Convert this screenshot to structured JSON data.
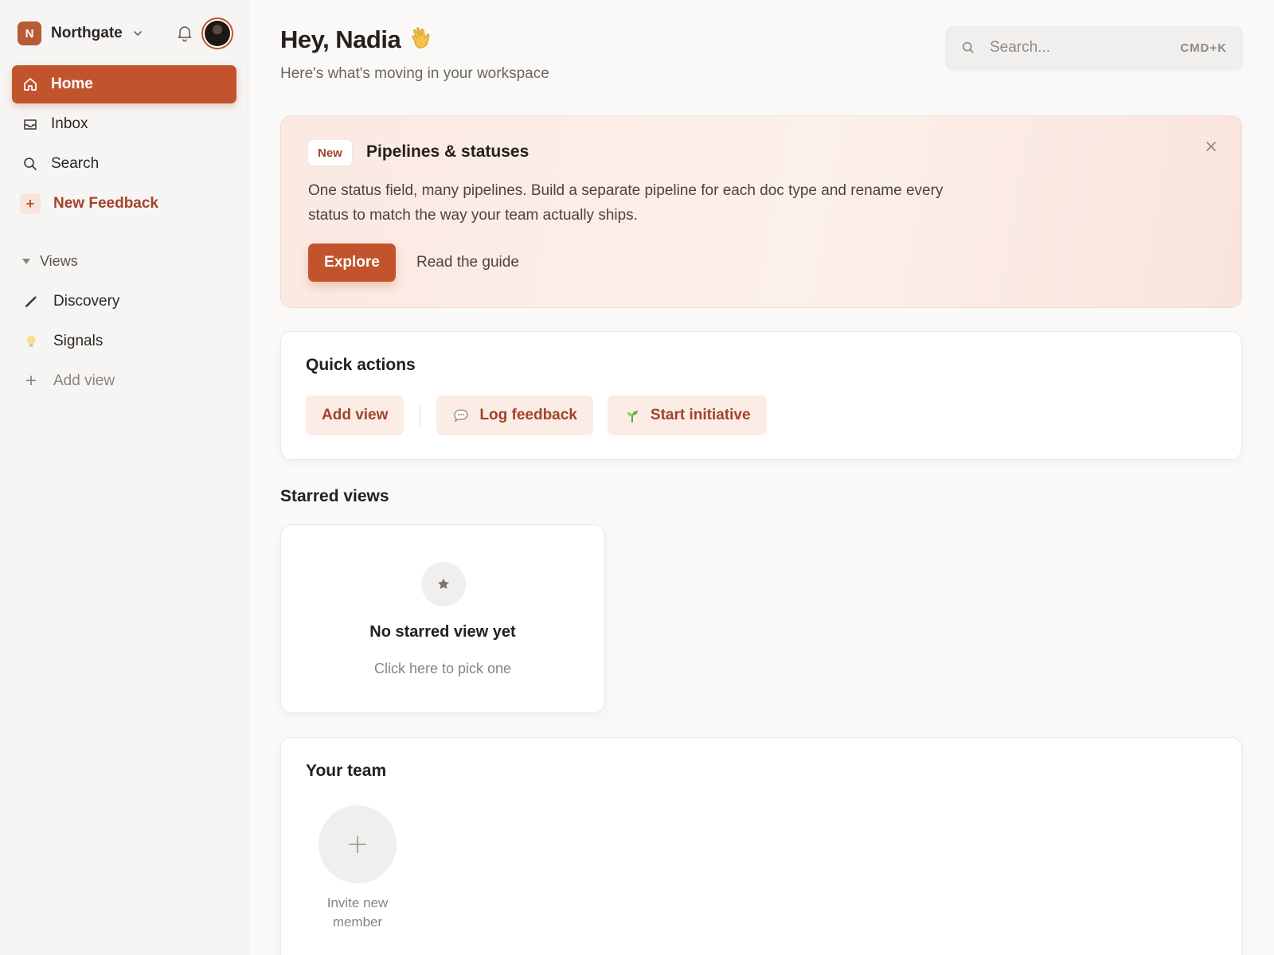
{
  "workspace": {
    "initial": "N",
    "name": "Northgate"
  },
  "nav": [
    {
      "label": "Home",
      "icon": "home-icon"
    },
    {
      "label": "Inbox",
      "icon": "inbox-icon"
    },
    {
      "label": "Search",
      "icon": "search-icon"
    },
    {
      "label": "New Feedback",
      "icon": "plus-icon"
    }
  ],
  "views": {
    "heading": "Views",
    "items": [
      {
        "label": "Discovery",
        "icon": "pen-icon"
      },
      {
        "label": "Signals",
        "icon": "lightbulb-icon"
      },
      {
        "label": "Add view",
        "icon": "plus-icon"
      }
    ]
  },
  "header": {
    "greeting": "Hey, Nadia",
    "subtitle": "Here's what's moving in your workspace"
  },
  "search": {
    "placeholder": "Search...",
    "shortcut": "CMD+K"
  },
  "banner": {
    "badge": "New",
    "title": "Pipelines & statuses",
    "text": "One status field, many pipelines. Build a separate pipeline for each doc type and rename every status to match the way your team actually ships.",
    "primary_label": "Explore",
    "secondary_label": "Read the guide"
  },
  "quick_actions": {
    "title": "Quick actions",
    "add_view": "Add view",
    "log_feedback": "Log feedback",
    "start_initiative": "Start initiative"
  },
  "starred": {
    "heading": "Starred views",
    "empty_title": "No starred view yet",
    "empty_sub": "Click here to pick one"
  },
  "team": {
    "title": "Your team",
    "invite_label": "Invite new member"
  },
  "colors": {
    "accent": "#c2542d",
    "accent_text": "#a2432a",
    "background": "#faf9f8"
  }
}
